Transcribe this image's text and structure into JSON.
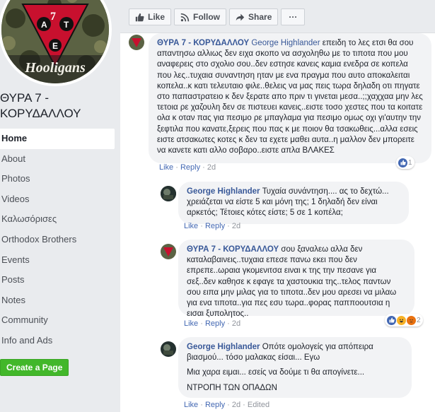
{
  "page": {
    "name": "ΘΥΡΑ 7 - ΚΟΡΥΔΑΛΛΟΥ",
    "logo_text": "Hooligans"
  },
  "sidebar": {
    "items": [
      {
        "label": "Home"
      },
      {
        "label": "About"
      },
      {
        "label": "Photos"
      },
      {
        "label": "Videos"
      },
      {
        "label": "Καλωσόρισες"
      },
      {
        "label": "Orthodox Brothers"
      },
      {
        "label": "Events"
      },
      {
        "label": "Posts"
      },
      {
        "label": "Notes"
      },
      {
        "label": "Community"
      },
      {
        "label": "Info and Ads"
      }
    ],
    "create_page": "Create a Page"
  },
  "actions": {
    "like": "Like",
    "follow": "Follow",
    "share": "Share",
    "more": "···"
  },
  "comments": [
    {
      "author": "ΘΥΡΑ 7 - ΚΟΡΥΔΑΛΛΟΥ",
      "reply_to": "George Highlander",
      "text": " επειδη το λες ετσι θα σου απαντησω αλλιως δεν ειχα σκοπο να ασχοληθω με το τιποτα που μου αναφερεις στο σχολιο σου..δεν εστησε κανεις καμια ενεδρα σε κοπελα που λες..τυχαια συναντηση ηταν με ενα πραγμα που αυτο αποκαλειται κοπελα..κ κατι τελευταιο φιλε..θελεις να μας πεις τωρα δηλαδη οτι πηγατε στο παπαστρατειο κ δεν ξερατε απο πριν τι γινεται μεσα..;;χαχχαα μην λες τετοια ρε χαζουλη δεν σε πιστευει κανεις..ειστε τοσο χεστες που τα κοιτατε ολα κ οταν πας για πεσιμο ρε μπαγλαμα για πεσιμο ομως οχι γι'αυτην την ξεφτιλα που κανατε,ξερεις που πας κ με ποιον θα τσακωθεις...αλλα εσεις ειστε ατσακωτες κοτες κ δεν τα εχετε μαθει αυτα..η μαλλον δεν μπορειτε να κανετε κατι αλλο σοβαρο..ειστε απλα ΒΛΑΚΕΣ",
      "like": "Like",
      "reply": "Reply",
      "time": "2d",
      "reactions": "1"
    },
    {
      "author": "George Highlander",
      "text": " Τυχαία συνάντηση.... ας το δεχτώ... χρειάζεται να είστε 5 και μόνη της; 1 δηλαδή δεν είναι αρκετός; Τέτοιες κότες είστε; 5 σε 1 κοπέλα;",
      "like": "Like",
      "reply": "Reply",
      "time": "2d"
    },
    {
      "author": "ΘΥΡΑ 7 - ΚΟΡΥΔΑΛΛΟΥ",
      "text": " σου ξαναλεω αλλα δεν καταλαβαινεις..τυχαια επεσε πανω εκει που δεν επρεπε..ωραια γκομενιτσα ειναι κ της την πεσανε για σεξ..δεν καθησε κ εφαγε τα χαστουκια της..τελος παντων σου ειπα μην μιλας για το τιποτα..δεν μου αρεσει να μιλαω για ενα τιποτα..για πες εσυ τωρα..φορας παπποουτσια η εισαι ξυπολητος..",
      "like": "Like",
      "reply": "Reply",
      "time": "2d",
      "reactions": "2"
    },
    {
      "author": "George Highlander",
      "text": " Οπότε ομολογείς για απόπειρα βιασμού... τόσο μαλακας είσαι... Εγω",
      "text2": "Μια χαρα ειμαι... εσείς να δούμε τι θα απογίνετε...",
      "text3": "ΝΤΡΟΠΗ ΤΩΝ ΟΠΑΔΩΝ",
      "like": "Like",
      "reply": "Reply",
      "time": "2d",
      "edited": "Edited"
    }
  ],
  "colors": {
    "link": "#385898",
    "like_blue": "#4267b2",
    "create_green": "#42b72a"
  }
}
